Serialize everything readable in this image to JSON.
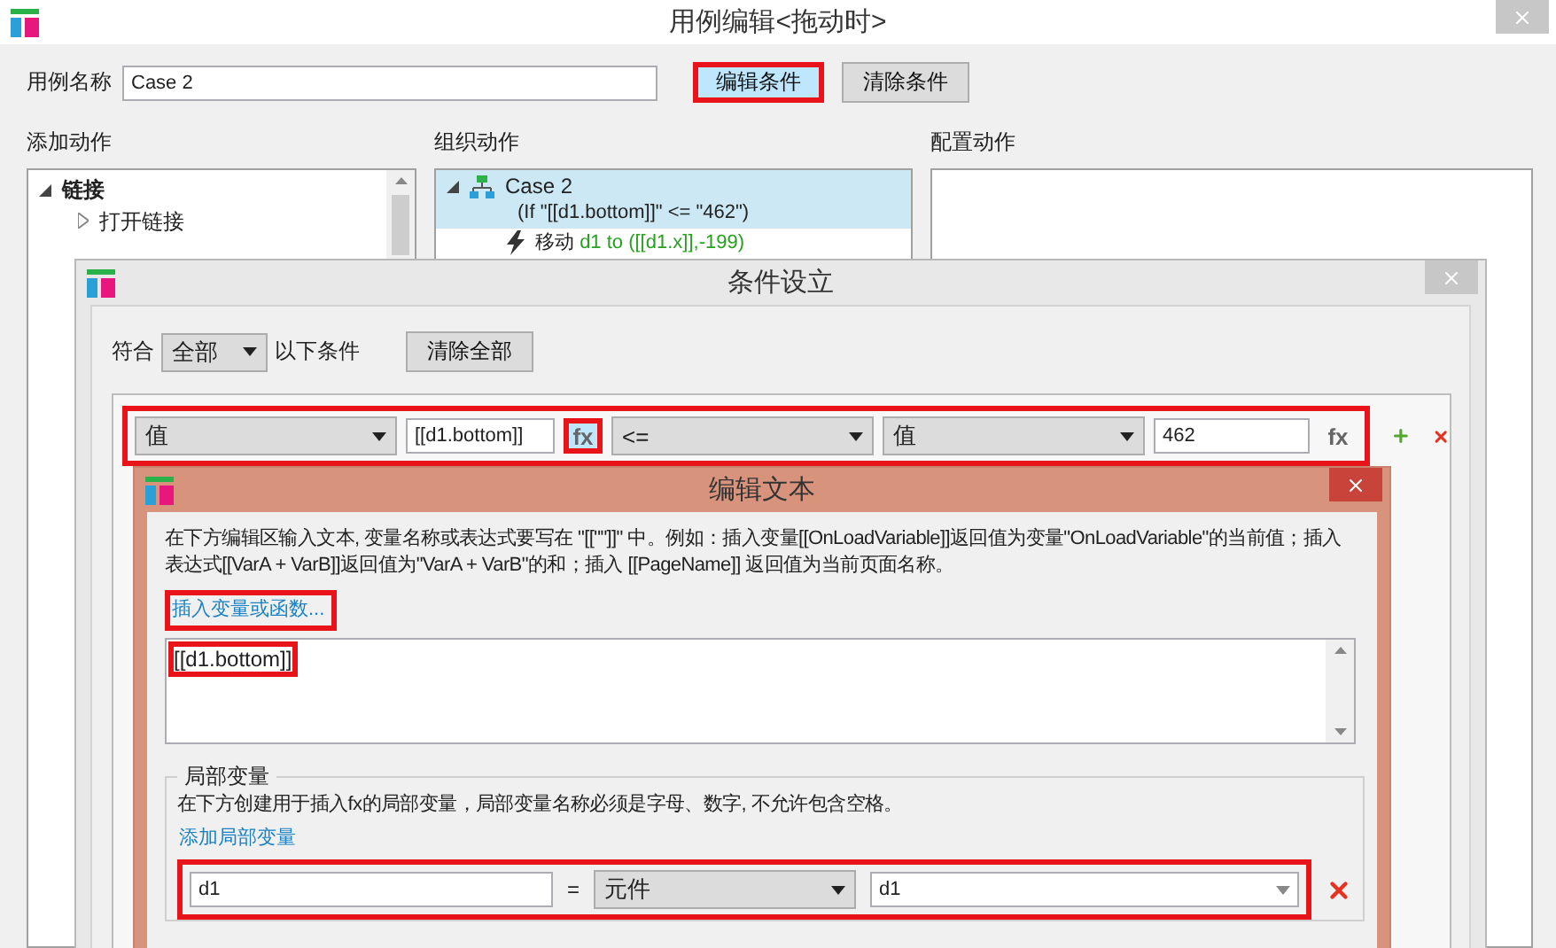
{
  "main_window": {
    "title": "用例编辑<拖动时>",
    "case_name_label": "用例名称",
    "case_name": "Case 2",
    "buttons": [
      {
        "label": "编辑条件",
        "selected": true,
        "highlighted": true
      },
      {
        "label": "清除条件",
        "selected": false,
        "highlighted": false
      }
    ],
    "add_actions": {
      "heading": "添加动作",
      "tree": [
        {
          "label": "链接",
          "expanded": true,
          "children": [
            {
              "label": "打开链接",
              "expanded": false
            }
          ]
        }
      ]
    },
    "organize_actions": {
      "heading": "组织动作",
      "case": {
        "label": "Case 2",
        "condition": "(If \"[[d1.bottom]]\" <= \"462\")",
        "selected": true
      },
      "actions": [
        {
          "verb": "移动",
          "detail": "d1 to ([[d1.x]],-199)"
        }
      ]
    },
    "configure_actions": {
      "heading": "配置动作"
    }
  },
  "condition_dialog": {
    "title": "条件设立",
    "match_label": "符合",
    "match_value": "全部",
    "match_suffix": "以下条件",
    "clear_all": "清除全部",
    "condition": {
      "highlighted": true,
      "fields": [
        {
          "kind": "dropdown",
          "value": "值"
        },
        {
          "kind": "input",
          "value": "[[d1.bottom]]"
        },
        {
          "kind": "fx",
          "label": "fx",
          "highlighted": true
        },
        {
          "kind": "dropdown",
          "value": "<="
        },
        {
          "kind": "dropdown",
          "value": "值"
        },
        {
          "kind": "input",
          "value": "462"
        },
        {
          "kind": "fx",
          "label": "fx",
          "highlighted": false
        }
      ]
    }
  },
  "edit_text_dialog": {
    "title": "编辑文本",
    "description": "在下方编辑区输入文本, 变量名称或表达式要写在 \"[[\"\"]]\" 中。例如：插入变量[[OnLoadVariable]]返回值为变量\"OnLoadVariable\"的当前值；插入表达式[[VarA + VarB]]返回值为\"VarA + VarB\"的和；插入 [[PageName]] 返回值为当前页面名称。",
    "insert_link": {
      "label": "插入变量或函数...",
      "highlighted": true
    },
    "text": {
      "value": "[[d1.bottom]]",
      "highlighted": true
    },
    "local_variables": {
      "legend": "局部变量",
      "description": "在下方创建用于插入fx的局部变量，局部变量名称必须是字母、数字, 不允许包含空格。",
      "add_link": "添加局部变量",
      "rows": [
        {
          "name": "d1",
          "operator": "=",
          "type": "元件",
          "target": "d1",
          "highlighted": true
        }
      ]
    }
  }
}
